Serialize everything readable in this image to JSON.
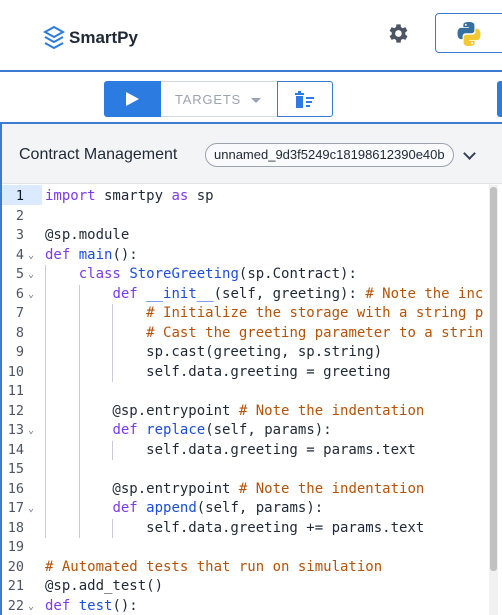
{
  "header": {
    "brand": "SmartPy",
    "settings_icon": "gear-icon",
    "python_icon": "python-logo-icon",
    "accent": "#3d7bd3"
  },
  "toolbar": {
    "run_icon": "play-icon",
    "targets_label": "TARGETS",
    "clear_icon": "clear-output-icon",
    "primary_color": "#2b7be0"
  },
  "panel": {
    "title": "Contract Management",
    "contract_name": "unnamed_9d3f5249c18198612390e40b"
  },
  "editor": {
    "active_line": 1,
    "lines": [
      {
        "n": "1",
        "text": "import smartpy as sp"
      },
      {
        "n": "2",
        "text": ""
      },
      {
        "n": "3",
        "text": "@sp.module"
      },
      {
        "n": "4",
        "text": "def main():"
      },
      {
        "n": "5",
        "text": "    class StoreGreeting(sp.Contract):"
      },
      {
        "n": "6",
        "text": "        def __init__(self, greeting): # Note the inc"
      },
      {
        "n": "7",
        "text": "            # Initialize the storage with a string p"
      },
      {
        "n": "8",
        "text": "            # Cast the greeting parameter to a strin"
      },
      {
        "n": "9",
        "text": "            sp.cast(greeting, sp.string)"
      },
      {
        "n": "10",
        "text": "            self.data.greeting = greeting"
      },
      {
        "n": "11",
        "text": ""
      },
      {
        "n": "12",
        "text": "        @sp.entrypoint # Note the indentation"
      },
      {
        "n": "13",
        "text": "        def replace(self, params):"
      },
      {
        "n": "14",
        "text": "            self.data.greeting = params.text"
      },
      {
        "n": "15",
        "text": ""
      },
      {
        "n": "16",
        "text": "        @sp.entrypoint # Note the indentation"
      },
      {
        "n": "17",
        "text": "        def append(self, params):"
      },
      {
        "n": "18",
        "text": "            self.data.greeting += params.text"
      },
      {
        "n": "19",
        "text": ""
      },
      {
        "n": "20",
        "text": "# Automated tests that run on simulation"
      },
      {
        "n": "21",
        "text": "@sp.add_test()"
      },
      {
        "n": "22",
        "text": "def test():"
      }
    ]
  }
}
